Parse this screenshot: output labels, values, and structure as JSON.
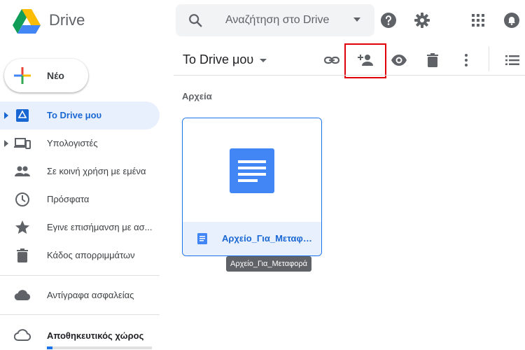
{
  "app": {
    "name": "Drive"
  },
  "search": {
    "placeholder": "Αναζήτηση στο Drive"
  },
  "header": {
    "icons": [
      "help-icon",
      "settings-icon",
      "apps-grid-icon",
      "notifications-icon"
    ]
  },
  "sidebar": {
    "new_label": "Νέο",
    "items": [
      {
        "label": "Το Drive μου",
        "icon": "my-drive-icon",
        "active": true
      },
      {
        "label": "Υπολογιστές",
        "icon": "computers-icon"
      },
      {
        "label": "Σε κοινή χρήση με εμένα",
        "icon": "shared-people-icon"
      },
      {
        "label": "Πρόσφατα",
        "icon": "clock-icon"
      },
      {
        "label": "Εγινε επισήμανση με ασ...",
        "icon": "star-icon"
      },
      {
        "label": "Κάδος απορριμμάτων",
        "icon": "trash-icon"
      },
      {
        "label": "Αντίγραφα ασφαλείας",
        "icon": "cloud-icon"
      },
      {
        "label": "Αποθηκευτικός χώρος",
        "icon": "cloud-outline-icon"
      }
    ]
  },
  "toolbar": {
    "breadcrumb": "Το Drive μου",
    "icons": [
      "get-link-icon",
      "share-add-person-icon",
      "preview-eye-icon",
      "delete-icon",
      "more-vert-icon",
      "list-view-icon"
    ]
  },
  "content": {
    "section_label": "Αρχεία",
    "file": {
      "name": "Αρχείο_Για_Μεταφορά",
      "type": "google-doc"
    },
    "tooltip": "Αρχείο_Για_Μεταφορά"
  },
  "colors": {
    "accent": "#1a73e8",
    "active_bg": "#e8f0fe",
    "highlight": "#e0000b"
  }
}
